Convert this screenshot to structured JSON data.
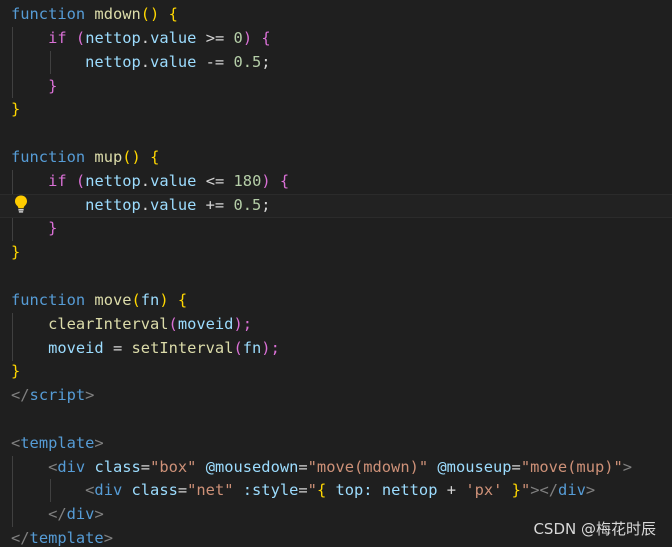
{
  "code": {
    "l1": [
      "function",
      "mdown",
      "()",
      "{"
    ],
    "l2": [
      "if",
      "(",
      "nettop",
      ".",
      "value",
      ">=",
      "0",
      ")",
      "{"
    ],
    "l3": [
      "nettop",
      ".",
      "value",
      "-=",
      "0.5",
      ";"
    ],
    "l4": [
      "}"
    ],
    "l5": [
      "}"
    ],
    "l7": [
      "function",
      "mup",
      "()",
      "{"
    ],
    "l8": [
      "if",
      "(",
      "nettop",
      ".",
      "value",
      "<=",
      "180",
      ")",
      "{"
    ],
    "l9": [
      "nettop",
      ".",
      "value",
      "+=",
      "0.5",
      ";"
    ],
    "l10": [
      "}"
    ],
    "l11": [
      "}"
    ],
    "l13": [
      "function",
      "move",
      "(",
      "fn",
      ")",
      "{"
    ],
    "l14": [
      "clearInterval",
      "(",
      "moveid",
      ");"
    ],
    "l15": [
      "moveid",
      "=",
      "setInterval",
      "(",
      "fn",
      ");"
    ],
    "l16": [
      "}"
    ],
    "l17": [
      "</",
      "script",
      ">"
    ],
    "l19": [
      "<",
      "template",
      ">"
    ],
    "l20": [
      "<",
      "div",
      "class",
      "=",
      "\"box\"",
      "@mousedown",
      "=",
      "\"move(mdown)\"",
      "@mouseup",
      "=",
      "\"move(mup)\"",
      ">"
    ],
    "l21": [
      "<",
      "div",
      "class",
      "=",
      "\"net\"",
      ":style",
      "=",
      "\"",
      "{",
      "top:",
      "nettop",
      "+",
      "'px'",
      "}",
      "\"",
      "></",
      "div",
      ">"
    ],
    "l22": [
      "</",
      "div",
      ">"
    ],
    "l23": [
      "</",
      "template",
      ">"
    ]
  },
  "lightbulb_icon": "lightbulb-icon",
  "watermark": "CSDN @梅花时辰",
  "colors": {
    "background": "#1f1f1f",
    "keyword": "#569cd6",
    "function": "#dcdcaa",
    "variable": "#9cdcfe",
    "number": "#b5cea8",
    "string": "#ce9178",
    "bracket_gold": "#ffd700",
    "bracket_purple": "#da70d6"
  }
}
